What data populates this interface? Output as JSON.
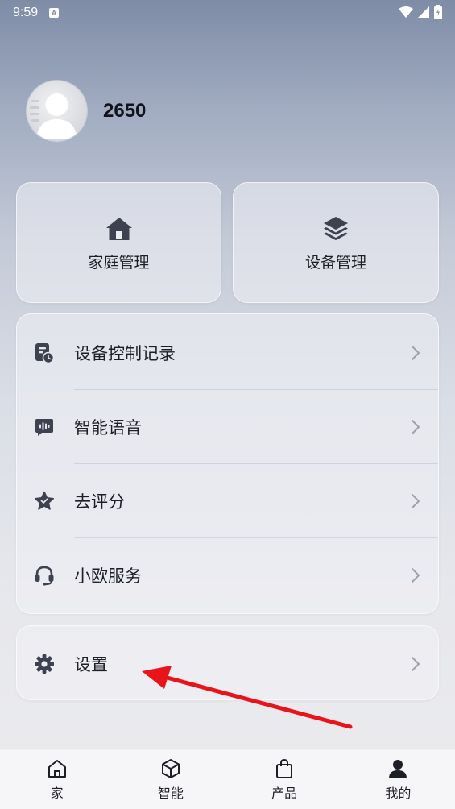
{
  "status_bar": {
    "time": "9:59",
    "notification_letter": "A"
  },
  "profile": {
    "username": "2650"
  },
  "tiles": [
    {
      "label": "家庭管理",
      "icon": "home-icon"
    },
    {
      "label": "设备管理",
      "icon": "layers-icon"
    }
  ],
  "menu": [
    {
      "label": "设备控制记录",
      "icon": "record-clock-icon"
    },
    {
      "label": "智能语音",
      "icon": "voice-chat-icon"
    },
    {
      "label": "去评分",
      "icon": "star-icon"
    },
    {
      "label": "小欧服务",
      "icon": "headset-icon"
    }
  ],
  "settings": {
    "label": "设置",
    "icon": "gear-icon"
  },
  "bottom_nav": [
    {
      "label": "家",
      "icon": "home-outline-icon"
    },
    {
      "label": "智能",
      "icon": "cube-icon"
    },
    {
      "label": "产品",
      "icon": "shopping-bag-icon"
    },
    {
      "label": "我的",
      "icon": "person-icon",
      "active": true
    }
  ],
  "colors": {
    "accent": "#1d1f26",
    "annotation_arrow": "#e8141a",
    "icon": "#3d4150"
  }
}
